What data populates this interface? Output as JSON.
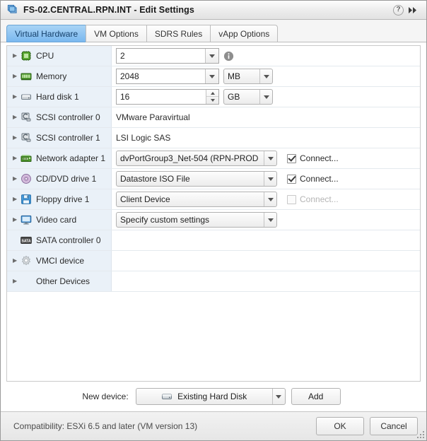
{
  "window": {
    "title": "FS-02.CENTRAL.RPN.INT - Edit Settings",
    "vm_icon": "virtual-machine-icon",
    "help_label": "?",
    "expand_label": "▶▶"
  },
  "tabs": [
    {
      "label": "Virtual Hardware",
      "active": true
    },
    {
      "label": "VM Options",
      "active": false
    },
    {
      "label": "SDRS Rules",
      "active": false
    },
    {
      "label": "vApp Options",
      "active": false
    }
  ],
  "devices": [
    {
      "label": "CPU",
      "icon": "cpu-icon",
      "expandable": true,
      "control": "field-dropdown",
      "value": "2",
      "info_icon": "info-icon"
    },
    {
      "label": "Memory",
      "icon": "memory-icon",
      "expandable": true,
      "control": "field-dropdown-unit",
      "value": "2048",
      "unit": "MB"
    },
    {
      "label": "Hard disk 1",
      "icon": "harddisk-icon",
      "expandable": true,
      "control": "field-spinner-unit",
      "value": "16",
      "unit": "GB"
    },
    {
      "label": "SCSI controller 0",
      "icon": "scsi-controller-icon",
      "expandable": true,
      "control": "text",
      "value": "VMware Paravirtual"
    },
    {
      "label": "SCSI controller 1",
      "icon": "scsi-controller-icon",
      "expandable": true,
      "control": "text",
      "value": "LSI Logic SAS"
    },
    {
      "label": "Network adapter 1",
      "icon": "network-adapter-icon",
      "expandable": true,
      "control": "combo-connect",
      "value": "dvPortGroup3_Net-504 (RPN-PROD",
      "connect_label": "Connect...",
      "connected": true,
      "connect_disabled": false
    },
    {
      "label": "CD/DVD drive 1",
      "icon": "cddvd-icon",
      "expandable": true,
      "control": "combo-connect",
      "value": "Datastore ISO File",
      "connect_label": "Connect...",
      "connected": true,
      "connect_disabled": false
    },
    {
      "label": "Floppy drive 1",
      "icon": "floppy-icon",
      "expandable": true,
      "control": "combo-connect",
      "value": "Client Device",
      "connect_label": "Connect...",
      "connected": false,
      "connect_disabled": true
    },
    {
      "label": "Video card",
      "icon": "videocard-icon",
      "expandable": true,
      "control": "combo",
      "value": "Specify custom settings"
    },
    {
      "label": "SATA controller 0",
      "icon": "sata-controller-icon",
      "expandable": false,
      "control": "none",
      "value": ""
    },
    {
      "label": "VMCI device",
      "icon": "vmci-icon",
      "expandable": true,
      "control": "none",
      "value": ""
    },
    {
      "label": "Other Devices",
      "icon": "none",
      "expandable": true,
      "control": "none",
      "value": ""
    }
  ],
  "new_device": {
    "label": "New device:",
    "selected": "Existing Hard Disk",
    "selected_icon": "harddisk-icon",
    "add_label": "Add"
  },
  "footer": {
    "compatibility": "Compatibility: ESXi 6.5 and later (VM version 13)",
    "ok_label": "OK",
    "cancel_label": "Cancel"
  },
  "colors": {
    "accent": "#7ab8ef",
    "left_column": "#eaf1f8",
    "tab_active_text": "#16416b"
  }
}
